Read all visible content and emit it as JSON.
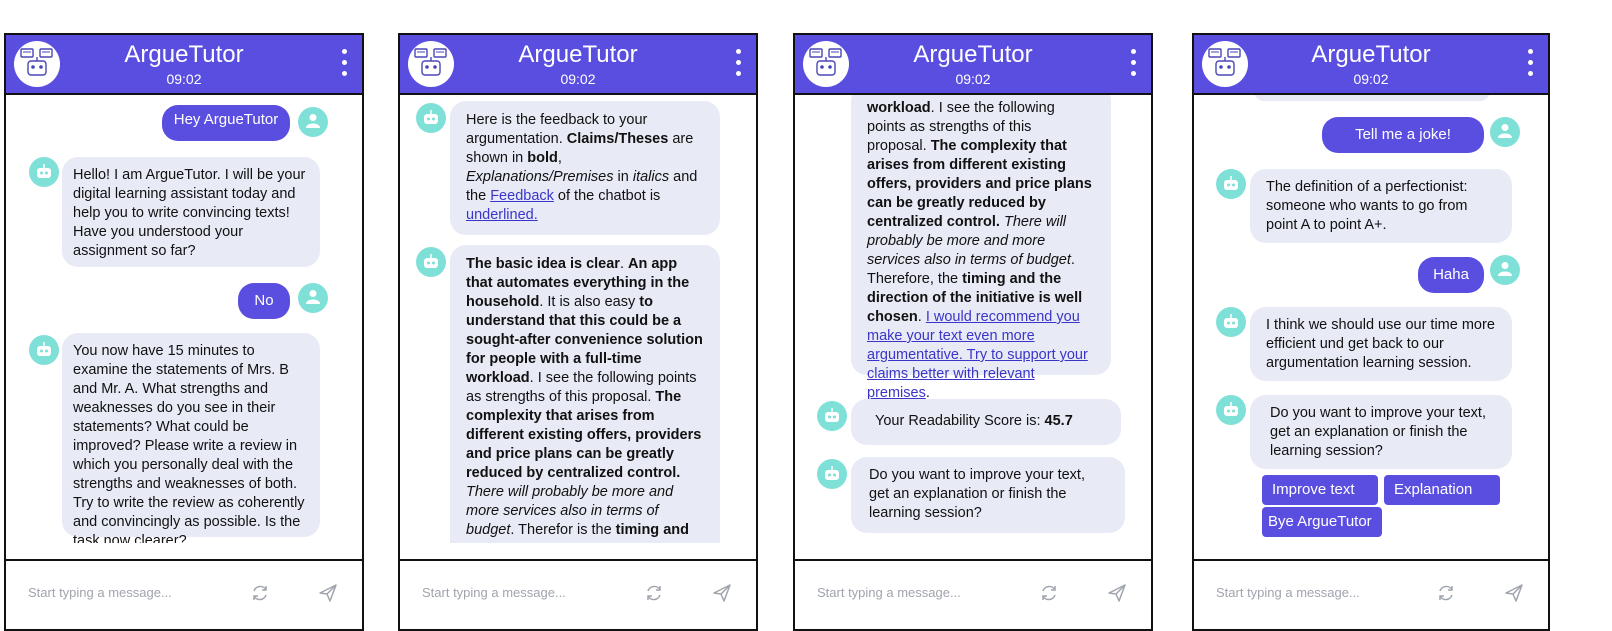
{
  "app": {
    "title": "ArgueTutor",
    "time": "09:02",
    "input_placeholder": "Start typing a message..."
  },
  "screen1": {
    "user_msg_1": "Hey ArgueTutor",
    "bot_msg_1": "Hello! I am ArgueTutor. I will be your digital learning assistant today and help you to write convincing texts! Have you understood your assignment so far?",
    "user_msg_2": "No",
    "bot_msg_2": "You now have 15 minutes to examine the statements of Mrs. B and Mr. A. What strengths and weaknesses do you see in their statements? What could be improved? Please write a review in which you personally deal with the strengths and weaknesses of both. Try to write the review as coherently and convincingly as possible. Is the task now clearer?"
  },
  "screen2": {
    "fb_intro": "Here is the feedback to your argumentation.",
    "fb_claims": "Claims/Theses",
    "fb_are_shown_in": "are shown in",
    "fb_bold": "bold",
    "fb_comma": ",",
    "fb_explanations": "Explanations/Premises",
    "fb_in": "in",
    "fb_italics": "italics",
    "fb_and_the": "and the",
    "fb_feedback": "Feedback",
    "fb_of_chatbot": "of the chatbot is",
    "fb_underlined": "underlined.",
    "t_b1": "The basic idea is clear",
    "t_dot1": ".",
    "t_b2": "An app that automates everything in the household",
    "t_p1": ". It is also easy",
    "t_b3": "to understand that this could be a sought-after convenience solution for people with a full-time workload",
    "t_p2": ". I see the following points as strengths of this proposal.",
    "t_b4": "The complexity that arises from different existing offers, providers and price plans can be greatly reduced by centralized control.",
    "t_i1": "There will probably be more and more services also in terms of budget",
    "t_p3": ". Therefor is the",
    "t_b5": "timing and"
  },
  "screen3": {
    "t_b_workload": "workload",
    "t_p1": ". I see the following points as strengths of this proposal.",
    "t_b2": "The complexity that arises from different existing offers, providers and price plans can be greatly reduced by centralized control.",
    "t_i1": "There will probably be more and more services also in terms of budget",
    "t_p2": ". Therefore, the",
    "t_b3": "timing and the direction of the initiative is well chosen",
    "t_p3": ".",
    "t_link": "I would recommend you make your text even more argumentative. Try to support your claims better with relevant premises",
    "t_p4": ".",
    "readability_label": "Your Readability Score is:",
    "readability_value": "45.7",
    "bot_question": "Do you want to improve your text, get an explanation or finish the learning session?"
  },
  "screen4": {
    "user_msg_1": "Tell me a joke!",
    "bot_msg_1": "The definition of a perfectionist: someone who wants to go from point A to point A+.",
    "user_msg_2": "Haha",
    "bot_msg_2": "I think we should use our time more efficient und get back to our argumentation learning session.",
    "bot_msg_3": "Do you want to improve your text, get an explanation or finish the learning session?",
    "btn_improve": "Improve text",
    "btn_explanation": "Explanation",
    "btn_bye": "Bye ArgueTutor"
  },
  "colors": {
    "header": "#5a4ee0",
    "bot_bubble": "#e8ebf6",
    "user_bubble": "#5a4ee0",
    "avatar_bg": "#7fe0d8",
    "link": "#3a35c8"
  },
  "icons": {
    "header_avatar": "robot-chat-icon",
    "bot_avatar": "robot-icon",
    "user_avatar": "user-icon",
    "menu": "kebab-menu-icon",
    "refresh": "refresh-icon",
    "send": "send-icon"
  }
}
